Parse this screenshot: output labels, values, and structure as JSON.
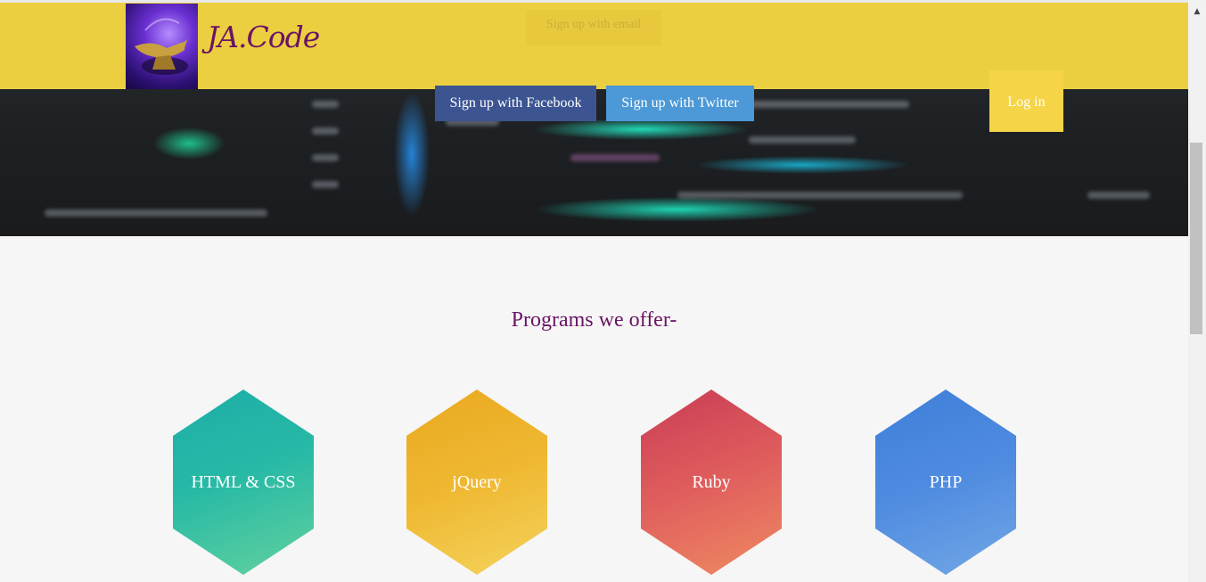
{
  "header": {
    "brand": "JA.Code",
    "logo_icon": "magic-lamp-image",
    "ghost_button_label": "Sign up with email",
    "buttons": {
      "facebook": "Sign up with Facebook",
      "twitter": "Sign up with Twitter",
      "login": "Log in"
    }
  },
  "colors": {
    "header_yellow": "#f5d642",
    "brand_purple": "#6a1464",
    "facebook": "#3c5592",
    "twitter": "#4d98d6"
  },
  "programs": {
    "title": "Programs we offer-",
    "items": [
      {
        "label": "HTML & CSS",
        "color": "#26b9a6"
      },
      {
        "label": "jQuery",
        "color": "#efb832"
      },
      {
        "label": "Ruby",
        "color": "#e05e5d"
      },
      {
        "label": "PHP",
        "color": "#4f8be0"
      }
    ]
  }
}
